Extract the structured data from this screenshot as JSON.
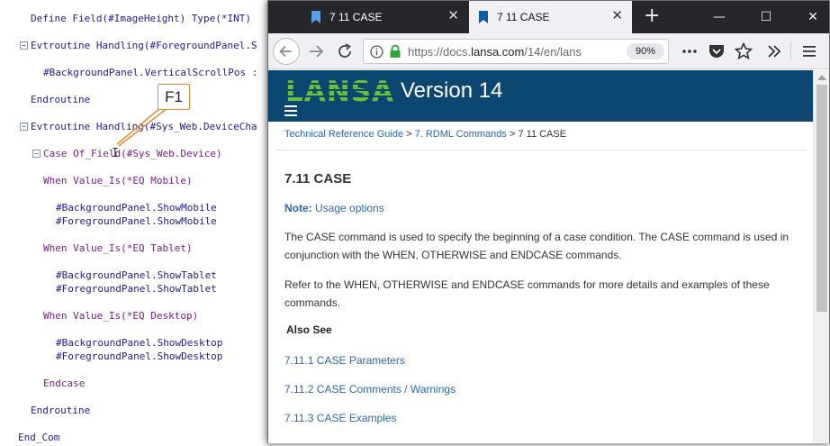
{
  "editor": {
    "lines": [
      {
        "text": "Define Field(#ImageHeight) Type(*INT) "
      },
      {
        "text": "Evtroutine Handling(#ForegroundPanel.S"
      },
      {
        "text": "#BackgroundPanel.VerticalScrollPos :"
      },
      {
        "text": "Endroutine"
      },
      {
        "text": "Evtroutine Handling(#Sys_Web.DeviceCha"
      },
      {
        "text": "Case Of_Field(#Sys_Web.Device)"
      },
      {
        "text": "When Value_Is(*EQ Mobile)"
      },
      {
        "text": "#BackgroundPanel.ShowMobile"
      },
      {
        "text": "#ForegroundPanel.ShowMobile"
      },
      {
        "text": "When Value_Is(*EQ Tablet)"
      },
      {
        "text": "#BackgroundPanel.ShowTablet"
      },
      {
        "text": "#ForegroundPanel.ShowTablet"
      },
      {
        "text": "When Value_Is(*EQ Desktop)"
      },
      {
        "text": "#BackgroundPanel.ShowDesktop"
      },
      {
        "text": "#ForegroundPanel.ShowDesktop"
      },
      {
        "text": "Endcase"
      },
      {
        "text": "Endroutine"
      },
      {
        "text": "End_Com"
      }
    ],
    "fold_glyph": "−",
    "callout_label": "F1",
    "text_cursor": "I"
  },
  "browser": {
    "tabs": [
      {
        "title": "7 11 CASE",
        "close": "✕"
      },
      {
        "title": "7 11 CASE",
        "close": "✕"
      }
    ],
    "new_tab": "+",
    "window_controls": {
      "minimize": "—",
      "maximize": "☐",
      "close": "✕"
    },
    "url": {
      "prefix": "https://docs.",
      "domain": "lansa.com",
      "path": "/14/en/lans"
    },
    "zoom": "90%"
  },
  "page": {
    "logo_text": "LANSA",
    "version_title": "Version 14",
    "breadcrumb": {
      "item1": "Technical Reference Guide",
      "sep": " > ",
      "item2": "7. RDML Commands",
      "item3": "7 11 CASE"
    },
    "heading": "7.11 CASE",
    "note_label": "Note:",
    "note_link": "Usage options",
    "paragraph1": "The CASE command is used to specify the beginning of a case condition. The CASE command is used in conjunction with the WHEN, OTHERWISE and ENDCASE commands.",
    "paragraph2": "Refer to the WHEN, OTHERWISE and ENDCASE commands for more details and examples of these commands.",
    "also_see": "Also See",
    "links": [
      "7.11.1 CASE Parameters",
      "7.11.2 CASE Comments / Warnings",
      "7.11.3 CASE Examples"
    ]
  },
  "colors": {
    "header_blue": "#0c4772",
    "logo_green": "#6abf3a",
    "link_blue": "#2a66b7",
    "tabbar_dark": "#26272a",
    "callout_orange": "#e58a2e",
    "lock_green": "#2fa33a"
  },
  "icons": [
    "info-icon",
    "lock-icon",
    "pocket-icon",
    "bookmark-star-icon",
    "more-actions-icon",
    "overflow-icon",
    "menu-icon",
    "hamburger-icon",
    "reload-icon",
    "back-arrow-icon",
    "forward-arrow-icon"
  ]
}
